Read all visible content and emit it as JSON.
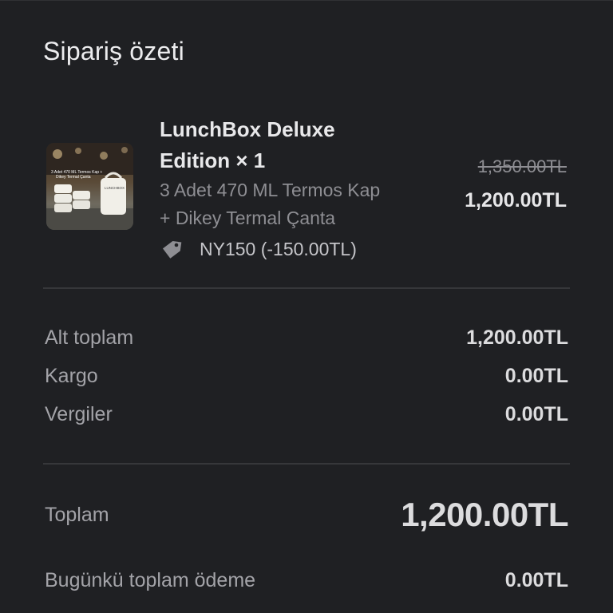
{
  "summary": {
    "title": "Sipariş özeti"
  },
  "item": {
    "name_line1": "LunchBox Deluxe",
    "name_line2": "Edition × 1",
    "variant_line1": "3 Adet 470 ML Termos Kap",
    "variant_line2": "+ Dikey Termal Çanta",
    "discount": "NY150 (-150.00TL)",
    "old_price": "1,350.00TL",
    "price": "1,200.00TL",
    "thumbnail_caption_line1": "3 Adet 470 ML Termos Kap +",
    "thumbnail_caption_line2": "Dikey Termal Çanta",
    "thumbnail_brand": "LUNCHBOX"
  },
  "totals": {
    "subtotal_label": "Alt toplam",
    "subtotal_value": "1,200.00TL",
    "shipping_label": "Kargo",
    "shipping_value": "0.00TL",
    "taxes_label": "Vergiler",
    "taxes_value": "0.00TL",
    "total_label": "Toplam",
    "total_value": "1,200.00TL",
    "due_today_label": "Bugünkü toplam ödeme",
    "due_today_value": "0.00TL"
  },
  "icons": {
    "discount": "tag-icon"
  },
  "colors": {
    "background": "#1f2023",
    "text": "#e6e6e8",
    "muted": "#8e8e93"
  }
}
